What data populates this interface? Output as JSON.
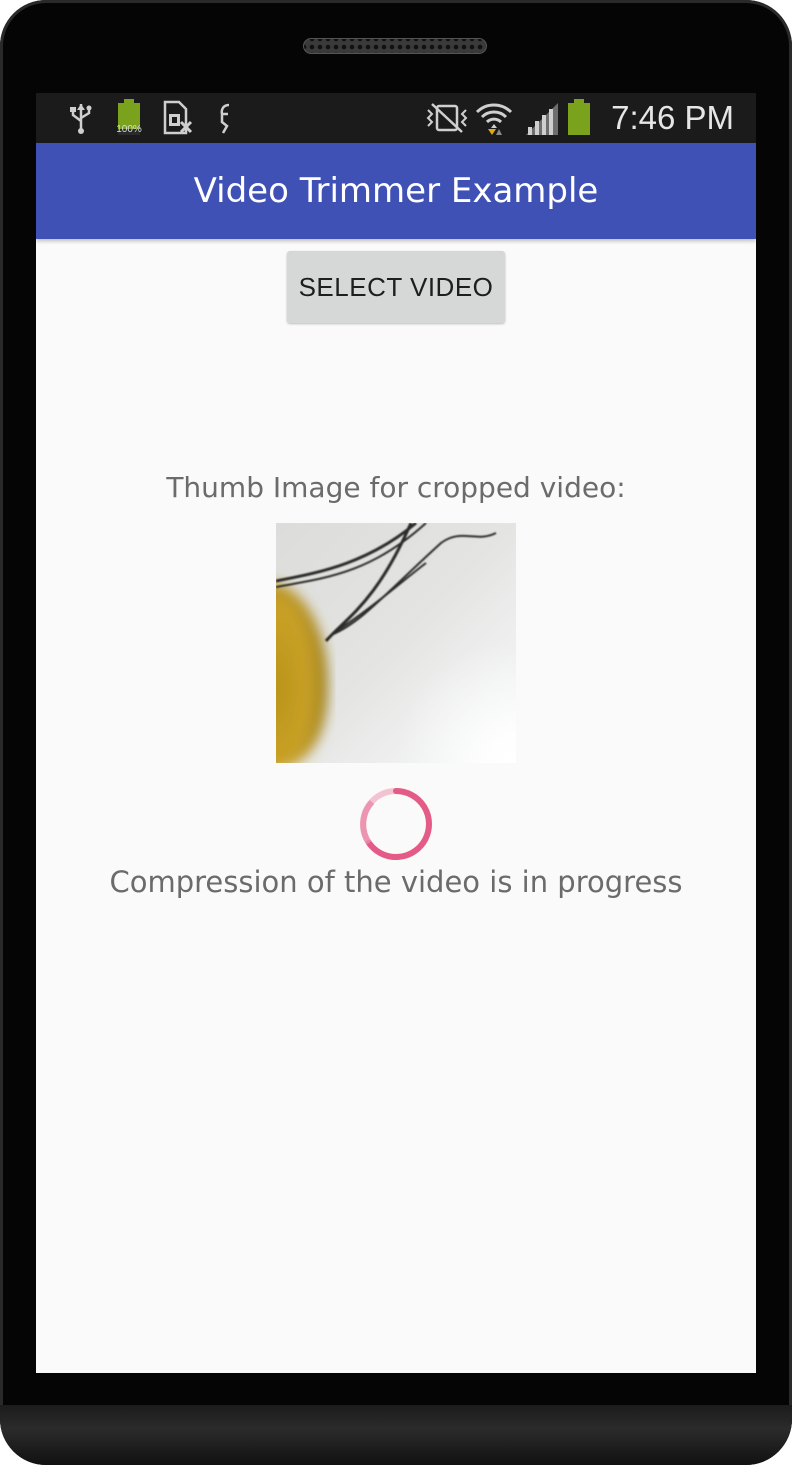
{
  "status_bar": {
    "time": "7:46 PM",
    "battery_percent_label": "100%",
    "left_icons": [
      "usb-icon",
      "battery-full-icon",
      "sim-card-missing-icon",
      "app-notification-icon"
    ],
    "right_icons": [
      "vibrate-mute-icon",
      "wifi-icon",
      "signal-icon",
      "battery-icon"
    ]
  },
  "app_bar": {
    "title": "Video Trimmer Example",
    "color": "#3f51b5"
  },
  "main": {
    "select_button_label": "SELECT VIDEO",
    "thumb_label": "Thumb Image for cropped video:",
    "thumb_image": "video-thumbnail",
    "progress_text": "Compression of the video is in progress",
    "spinner_color": "#e0497a"
  }
}
